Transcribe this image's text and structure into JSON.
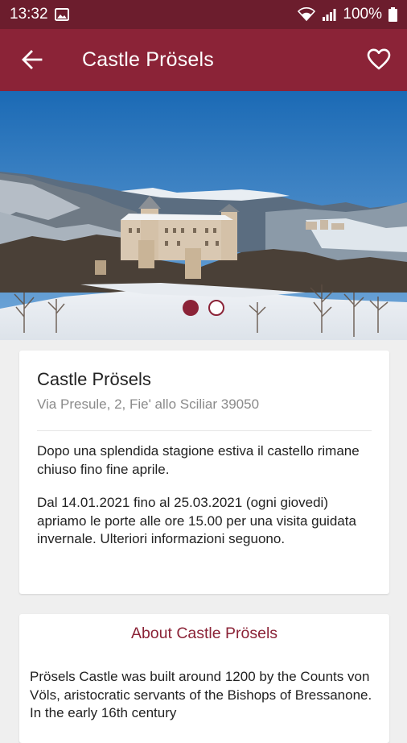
{
  "status_bar": {
    "time": "13:32",
    "battery": "100%",
    "icons": [
      "image-icon",
      "wifi-icon",
      "signal-icon",
      "battery-icon"
    ]
  },
  "app_bar": {
    "title": "Castle Prösels",
    "back_icon": "arrow-left-icon",
    "favorite_icon": "heart-outline-icon"
  },
  "carousel": {
    "image": "castle-in-winter-photo",
    "total_slides": 2,
    "active_slide": 1
  },
  "info_card": {
    "title": "Castle Prösels",
    "address": "Via Presule, 2, Fie' allo Sciliar 39050",
    "paragraphs": [
      "Dopo una splendida stagione estiva il castello rimane chiuso fino fine aprile.",
      "Dal 14.01.2021 fino al 25.03.2021 (ogni giovedi) apriamo le porte alle ore 15.00 per una visita guidata invernale. Ulteriori informazioni seguono."
    ]
  },
  "about_card": {
    "title": "About Castle Prösels",
    "text": "Prösels Castle was built around 1200 by the Counts von Völs, aristocratic servants of the Bishops of Bressanone. In the early 16th century"
  },
  "colors": {
    "status_bar": "#6c1d2d",
    "app_bar": "#8b2337",
    "accent": "#8b2337",
    "background": "#efefef"
  }
}
